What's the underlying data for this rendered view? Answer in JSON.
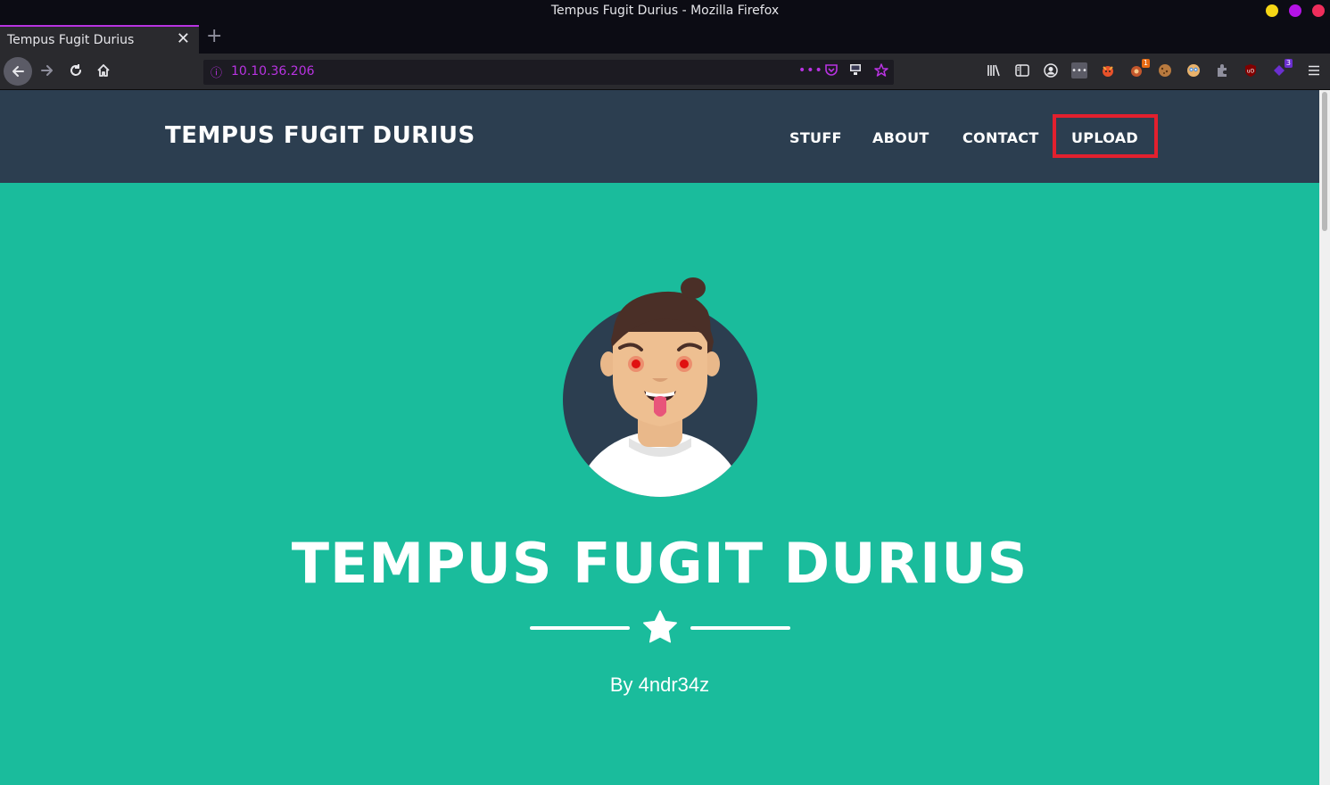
{
  "window": {
    "title": "Tempus Fugit Durius - Mozilla Firefox",
    "buttons": [
      {
        "name": "minimize",
        "color": "#f6d615"
      },
      {
        "name": "maximize",
        "color": "#b513e6"
      },
      {
        "name": "close",
        "color": "#ef2d5b"
      }
    ]
  },
  "tab": {
    "label": "Tempus Fugit Durius",
    "close_glyph": "✕",
    "new_tab_glyph": "+"
  },
  "toolbar": {
    "url": "10.10.36.206",
    "extension_badges": {
      "firefox_alpha": "1",
      "purple_ext": "3"
    }
  },
  "site": {
    "brand": "TEMPUS FUGIT DURIUS",
    "nav": [
      "STUFF",
      "ABOUT",
      "CONTACT",
      "UPLOAD"
    ],
    "highlighted_nav": "UPLOAD",
    "heading": "TEMPUS FUGIT DURIUS",
    "subheading": "By 4ndr34z",
    "colors": {
      "navbar": "#2c3e50",
      "masthead": "#1abc9c",
      "highlight": "#e3202e"
    }
  }
}
